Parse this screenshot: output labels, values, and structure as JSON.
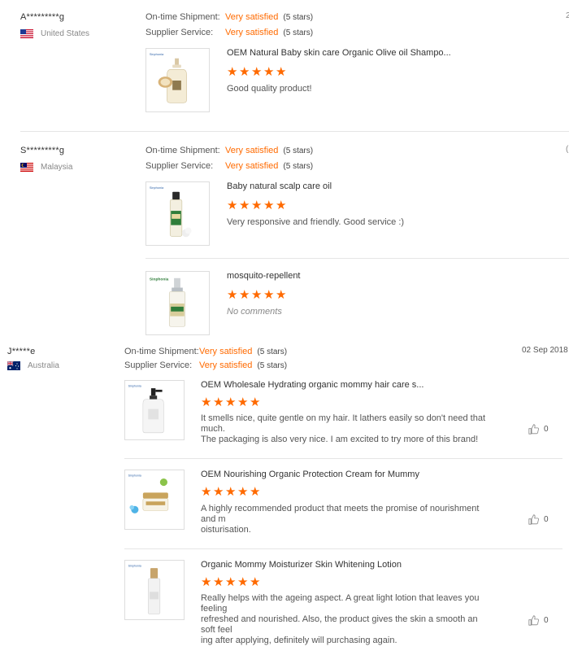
{
  "labels": {
    "shipment": "On-time Shipment:",
    "service": "Supplier Service:"
  },
  "colors": {
    "accent": "#ff6a00",
    "divider": "#e5e5e5"
  },
  "reviews": [
    {
      "buyer": "A*********g",
      "country": "United States",
      "flag": "us-flag-icon",
      "shipment": {
        "value": "Very satisfied",
        "stars": "(5 stars)"
      },
      "service": {
        "value": "Very satisfied",
        "stars": "(5 stars)"
      },
      "edge_mark": "2",
      "items": [
        {
          "title": "OEM Natural Baby skin care Organic Olive oil Shampo...",
          "rating": 5,
          "comment": "Good quality product!"
        }
      ]
    },
    {
      "buyer": "S*********g",
      "country": "Malaysia",
      "flag": "malaysia-flag-icon",
      "shipment": {
        "value": "Very satisfied",
        "stars": "(5 stars)"
      },
      "service": {
        "value": "Very satisfied",
        "stars": "(5 stars)"
      },
      "edge_mark": "(",
      "items": [
        {
          "title": "Baby natural scalp care oil",
          "rating": 5,
          "comment": "Very responsive and friendly. Good service :)"
        },
        {
          "title": "mosquito-repellent",
          "rating": 5,
          "comment": "No comments"
        }
      ]
    },
    {
      "buyer": "J*****e",
      "country": "Australia",
      "flag": "australia-flag-icon",
      "date": "02 Sep 2018",
      "shipment": {
        "value": "Very satisfied",
        "stars": "(5 stars)"
      },
      "service": {
        "value": "Very satisfied",
        "stars": "(5 stars)"
      },
      "items": [
        {
          "title": "OEM Wholesale Hydrating organic mommy hair care s...",
          "rating": 5,
          "comment_lines": [
            "It smells nice, quite gentle on my hair. It lathers easily so don't need that much.",
            "The packaging is also very nice. I am excited to try more of this brand!"
          ],
          "likes": "0"
        },
        {
          "title": "OEM Nourishing Organic Protection Cream for Mummy",
          "rating": 5,
          "comment_lines": [
            "A highly recommended product that meets the promise of nourishment and m",
            "oisturisation."
          ],
          "likes": "0"
        },
        {
          "title": "Organic Mommy Moisturizer Skin Whitening Lotion",
          "rating": 5,
          "comment_lines": [
            "Really helps with the ageing aspect. A great light lotion that leaves you feeling",
            "refreshed and nourished. Also, the product gives the skin a smooth an soft feel",
            "ing after applying, definitely will purchasing again."
          ],
          "likes": "0"
        }
      ]
    }
  ]
}
